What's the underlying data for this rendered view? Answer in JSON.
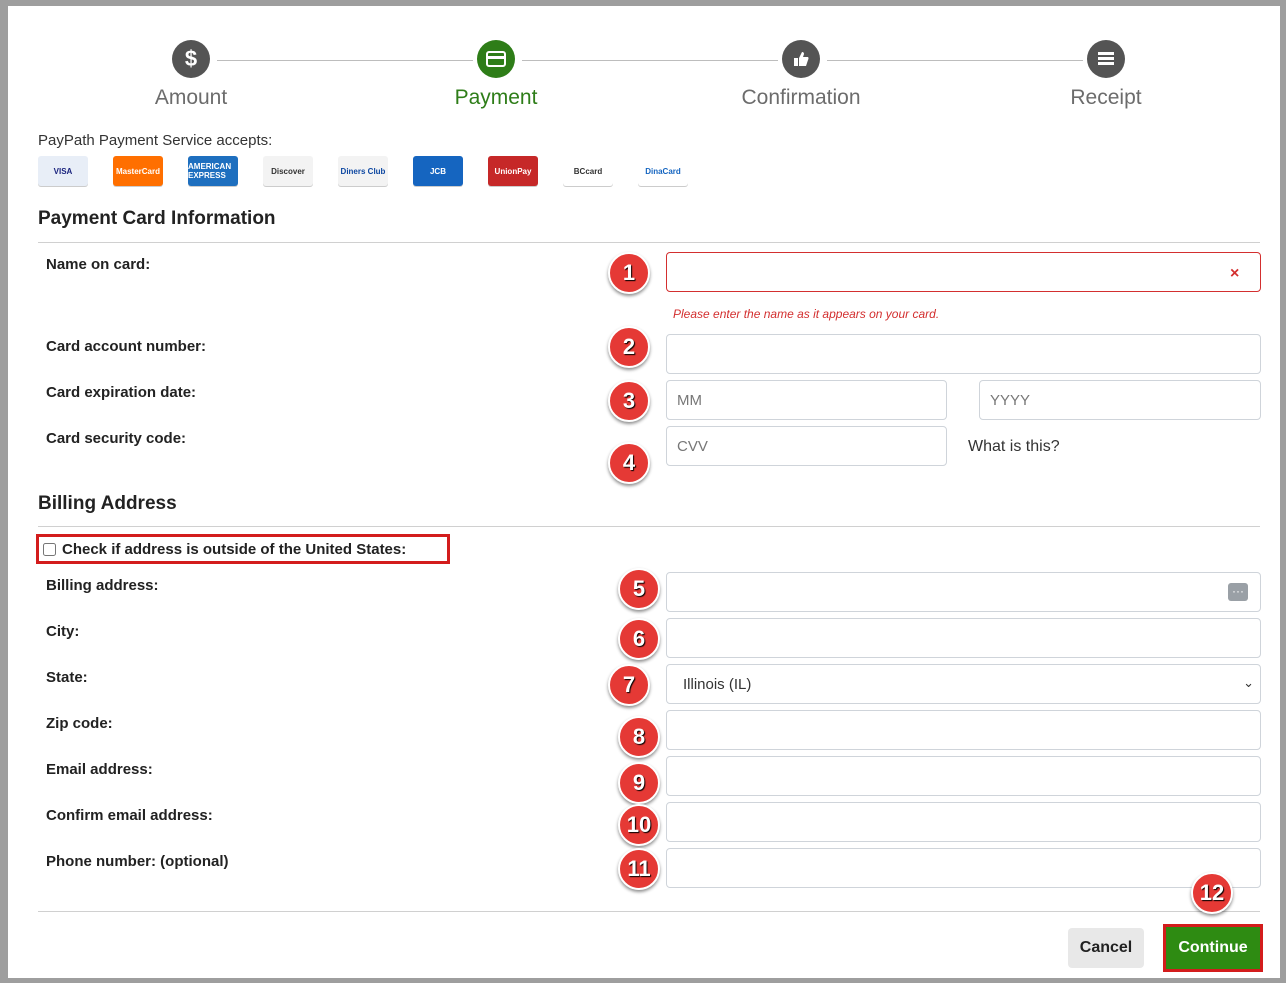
{
  "steps": [
    {
      "label": "Amount",
      "icon": "dollar-icon",
      "glyph": "$",
      "active": false
    },
    {
      "label": "Payment",
      "icon": "credit-card-icon",
      "glyph": "▭",
      "active": true
    },
    {
      "label": "Confirmation",
      "icon": "thumbs-up-icon",
      "glyph": "👍",
      "active": false
    },
    {
      "label": "Receipt",
      "icon": "list-icon",
      "glyph": "≣",
      "active": false
    }
  ],
  "accepts_text": "PayPath Payment Service accepts:",
  "card_logos": [
    {
      "name": "visa-logo",
      "text": "VISA",
      "color": "#e8eef7",
      "fg": "#1a237e"
    },
    {
      "name": "mastercard-logo",
      "text": "MasterCard",
      "color": "#ff6f00",
      "fg": "#ffffff"
    },
    {
      "name": "amex-logo",
      "text": "AMERICAN EXPRESS",
      "color": "#1e6fbf",
      "fg": "#ffffff"
    },
    {
      "name": "discover-logo",
      "text": "Discover",
      "color": "#f3f3f3",
      "fg": "#333333"
    },
    {
      "name": "diners-club-logo",
      "text": "Diners Club",
      "color": "#f3f3f3",
      "fg": "#0d47a1"
    },
    {
      "name": "jcb-logo",
      "text": "JCB",
      "color": "#1565c0",
      "fg": "#ffffff"
    },
    {
      "name": "unionpay-logo",
      "text": "UnionPay",
      "color": "#c62828",
      "fg": "#ffffff"
    },
    {
      "name": "bccard-logo",
      "text": "BCcard",
      "color": "#ffffff",
      "fg": "#333333"
    },
    {
      "name": "dinacard-logo",
      "text": "DinaCard",
      "color": "#ffffff",
      "fg": "#1565c0"
    }
  ],
  "payment_section_title": "Payment Card Information",
  "fields": {
    "name_on_card": {
      "label": "Name on card:",
      "value": "",
      "error_icon": "×",
      "error_message": "Please enter the name as it appears on your card."
    },
    "card_number": {
      "label": "Card account number:",
      "value": ""
    },
    "expiration": {
      "label": "Card expiration date:",
      "month_placeholder": "MM",
      "year_placeholder": "YYYY"
    },
    "security_code": {
      "label": "Card security code:",
      "placeholder": "CVV",
      "help_text": "What is this?"
    }
  },
  "billing_section_title": "Billing Address",
  "outside_us_label": "Check if address is outside of the United States:",
  "billing": {
    "address_label": "Billing address:",
    "city_label": "City:",
    "state_label": "State:",
    "state_value": "Illinois (IL)",
    "zip_label": "Zip code:",
    "email_label": "Email address:",
    "confirm_email_label": "Confirm email address:",
    "phone_label": "Phone number: (optional)"
  },
  "badges": [
    "1",
    "2",
    "3",
    "4",
    "5",
    "6",
    "7",
    "8",
    "9",
    "10",
    "11",
    "12"
  ],
  "buttons": {
    "cancel": "Cancel",
    "continue": "Continue"
  },
  "colors": {
    "accent_green": "#2e7d18",
    "error_red": "#d32f2f",
    "badge_red": "#e53935",
    "highlight_red": "#d31c1c"
  }
}
